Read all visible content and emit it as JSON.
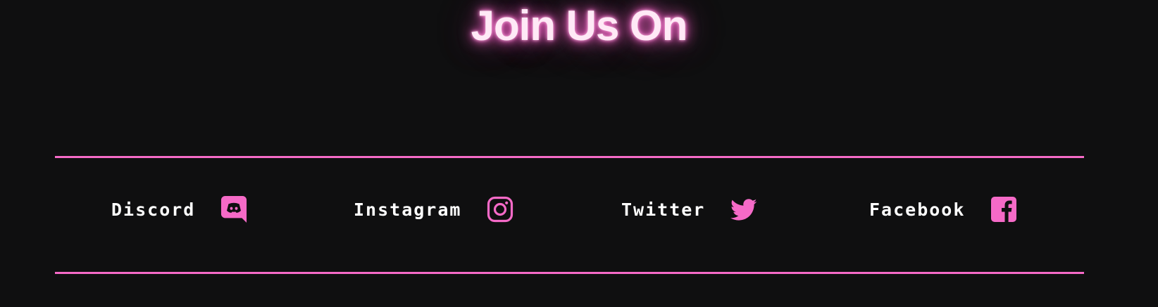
{
  "heading": {
    "title": "Join Us On"
  },
  "socials": [
    {
      "label": "Discord",
      "icon": "discord-icon"
    },
    {
      "label": "Instagram",
      "icon": "instagram-icon"
    },
    {
      "label": "Twitter",
      "icon": "twitter-icon"
    },
    {
      "label": "Facebook",
      "icon": "facebook-icon"
    }
  ],
  "colors": {
    "background": "#0f0f10",
    "accent": "#f56ac7",
    "text": "#ffffff"
  }
}
